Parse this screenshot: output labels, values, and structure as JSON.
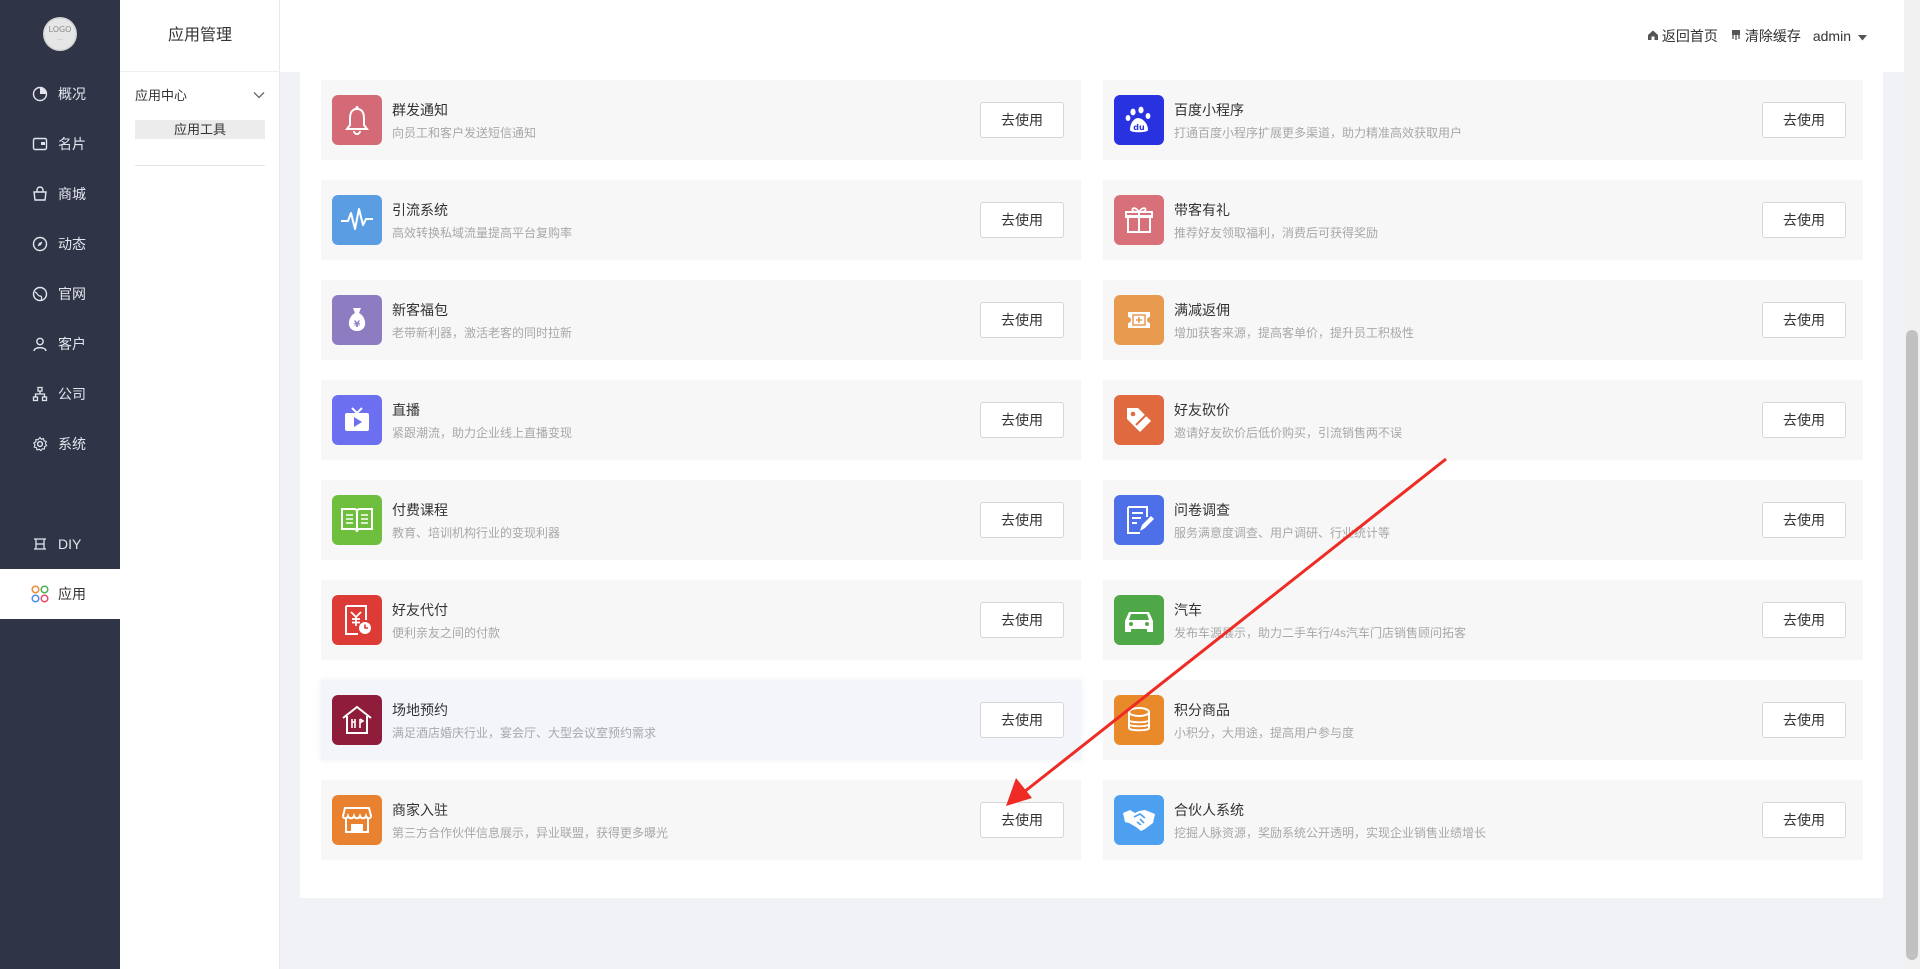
{
  "sidebar": {
    "logo_text": "Logo",
    "items": [
      {
        "label": "概况",
        "icon": "pie-chart-icon"
      },
      {
        "label": "名片",
        "icon": "card-icon"
      },
      {
        "label": "商城",
        "icon": "shop-icon"
      },
      {
        "label": "动态",
        "icon": "compass-icon"
      },
      {
        "label": "官网",
        "icon": "globe-icon"
      },
      {
        "label": "客户",
        "icon": "user-icon"
      },
      {
        "label": "公司",
        "icon": "org-chart-icon"
      },
      {
        "label": "系统",
        "icon": "gear-icon"
      },
      {
        "label": "DIY",
        "icon": "diy-icon"
      },
      {
        "label": "应用",
        "icon": "apps-icon",
        "active": true
      }
    ]
  },
  "submenu": {
    "title": "应用管理",
    "group_label": "应用中心",
    "item_label": "应用工具"
  },
  "header": {
    "home_label": "返回首页",
    "clear_cache_label": "清除缓存",
    "user_label": "admin"
  },
  "apps": [
    {
      "name": "群发通知",
      "desc": "向员工和客户发送短信通知",
      "button": "去使用",
      "color": "#d46a75",
      "icon": "bell-icon"
    },
    {
      "name": "百度小程序",
      "desc": "打通百度小程序扩展更多渠道，助力精准高效获取用户",
      "button": "去使用",
      "color": "#2932e1",
      "icon": "baidu-icon"
    },
    {
      "name": "引流系统",
      "desc": "高效转换私域流量提高平台复购率",
      "button": "去使用",
      "color": "#5b9de3",
      "icon": "pulse-icon"
    },
    {
      "name": "带客有礼",
      "desc": "推荐好友领取福利，消费后可获得奖励",
      "button": "去使用",
      "color": "#d8707a",
      "icon": "gift-icon"
    },
    {
      "name": "新客福包",
      "desc": "老带新利器，激活老客的同时拉新",
      "button": "去使用",
      "color": "#8e7cc3",
      "icon": "money-bag-icon"
    },
    {
      "name": "满减返佣",
      "desc": "增加获客来源，提高客单价，提升员工积极性",
      "button": "去使用",
      "color": "#e89a4f",
      "icon": "coupon-icon"
    },
    {
      "name": "直播",
      "desc": "紧跟潮流，助力企业线上直播变现",
      "button": "去使用",
      "color": "#6c6ff0",
      "icon": "tv-play-icon"
    },
    {
      "name": "好友砍价",
      "desc": "邀请好友砍价后低价购买，引流销售两不误",
      "button": "去使用",
      "color": "#e0693f",
      "icon": "price-tag-icon"
    },
    {
      "name": "付费课程",
      "desc": "教育、培训机构行业的变现利器",
      "button": "去使用",
      "color": "#6fbf3e",
      "icon": "book-icon"
    },
    {
      "name": "问卷调查",
      "desc": "服务满意度调查、用户调研、行业统计等",
      "button": "去使用",
      "color": "#4d6fe8",
      "icon": "survey-icon"
    },
    {
      "name": "好友代付",
      "desc": "便利亲友之间的付款",
      "button": "去使用",
      "color": "#dd3b35",
      "icon": "yuan-clock-icon"
    },
    {
      "name": "汽车",
      "desc": "发布车源展示，助力二手车行/4s汽车门店销售顾问拓客",
      "button": "去使用",
      "color": "#4fa848",
      "icon": "car-icon"
    },
    {
      "name": "场地预约",
      "desc": "满足酒店婚庆行业，宴会厅、大型会议室预约需求",
      "button": "去使用",
      "color": "#8e1c3a",
      "icon": "venue-icon"
    },
    {
      "name": "积分商品",
      "desc": "小积分，大用途，提高用户参与度",
      "button": "去使用",
      "color": "#e98a2a",
      "icon": "coins-icon"
    },
    {
      "name": "商家入驻",
      "desc": "第三方合作伙伴信息展示，异业联盟，获得更多曝光",
      "button": "去使用",
      "color": "#e88230",
      "icon": "store-icon"
    },
    {
      "name": "合伙人系统",
      "desc": "挖掘人脉资源，奖励系统公开透明，实现企业销售业绩增长",
      "button": "去使用",
      "color": "#4d9ff0",
      "icon": "handshake-icon"
    }
  ],
  "annotation": {
    "color": "#ee2b24",
    "icon": "red-arrow"
  }
}
